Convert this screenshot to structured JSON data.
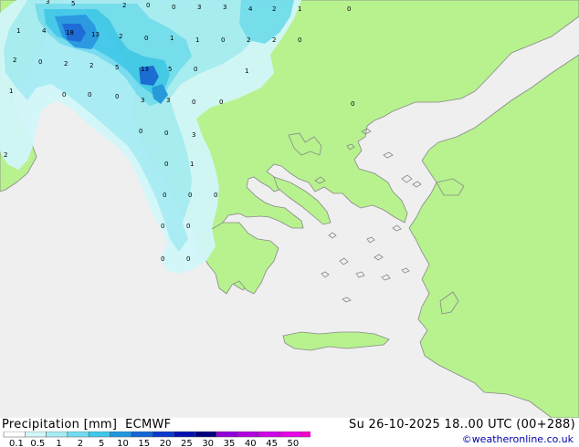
{
  "header": {
    "title": "Precipitation [mm]  ECMWF",
    "datetime": "Su 26-10-2025 18..00 UTC (00+288)",
    "credit": "©weatheronline.co.uk"
  },
  "colors": {
    "sea": "#efefef",
    "land": "#b7f28f",
    "coast": "#888888",
    "precip": [
      "#ffffff",
      "#d2f7fa",
      "#a7ecf5",
      "#73dcf0",
      "#3fc8ea",
      "#2196e0",
      "#1466d6",
      "#0a3acc",
      "#0511b0",
      "#00007c",
      "#9000d8",
      "#b100e0",
      "#d000e8",
      "#e800e8",
      "#f600c8"
    ]
  },
  "legend": {
    "labels": [
      "0.1",
      "0.5",
      "1",
      "2",
      "5",
      "10",
      "15",
      "20",
      "25",
      "30",
      "35",
      "40",
      "45",
      "50"
    ]
  },
  "map_labels": [
    {
      "text": "3"
    },
    {
      "text": "5"
    },
    {
      "text": "2"
    },
    {
      "text": "0"
    },
    {
      "text": "0"
    },
    {
      "text": "3"
    },
    {
      "text": "3"
    },
    {
      "text": "4"
    },
    {
      "text": "2"
    },
    {
      "text": "1"
    },
    {
      "text": "0"
    },
    {
      "text": "1"
    },
    {
      "text": "4"
    },
    {
      "text": "18"
    },
    {
      "text": "13"
    },
    {
      "text": "2"
    },
    {
      "text": "0"
    },
    {
      "text": "1"
    },
    {
      "text": "1"
    },
    {
      "text": "0"
    },
    {
      "text": "2"
    },
    {
      "text": "2"
    },
    {
      "text": "0"
    },
    {
      "text": "2"
    },
    {
      "text": "0"
    },
    {
      "text": "2"
    },
    {
      "text": "2"
    },
    {
      "text": "5"
    },
    {
      "text": "13"
    },
    {
      "text": "5"
    },
    {
      "text": "0"
    },
    {
      "text": "1"
    },
    {
      "text": "0"
    },
    {
      "text": "0"
    },
    {
      "text": "0"
    },
    {
      "text": "1"
    },
    {
      "text": "0"
    },
    {
      "text": "3"
    },
    {
      "text": "3"
    },
    {
      "text": "0"
    },
    {
      "text": "0"
    },
    {
      "text": "2"
    },
    {
      "text": "0"
    },
    {
      "text": "0"
    },
    {
      "text": "3"
    },
    {
      "text": "1"
    },
    {
      "text": "0"
    },
    {
      "text": "0"
    },
    {
      "text": "0"
    },
    {
      "text": "0"
    },
    {
      "text": "0"
    },
    {
      "text": "0"
    },
    {
      "text": "0"
    },
    {
      "text": "0"
    }
  ]
}
